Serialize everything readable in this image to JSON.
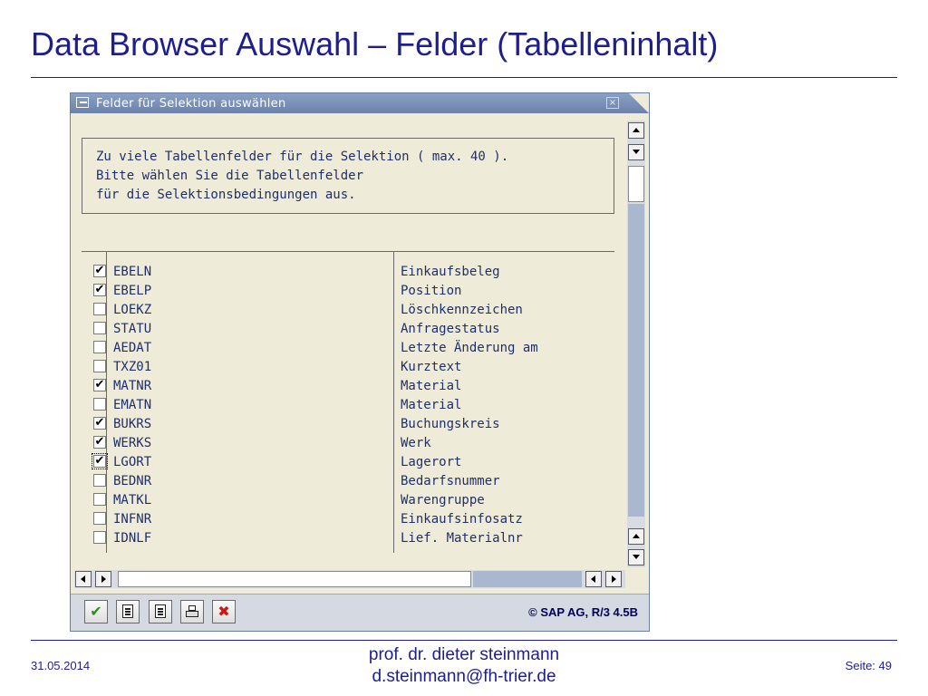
{
  "slide": {
    "title": "Data Browser Auswahl – Felder (Tabelleninhalt)"
  },
  "dialog": {
    "title": "Felder für Selektion auswählen",
    "message_lines": [
      "Zu viele Tabellenfelder für die Selektion ( max. 40 ).",
      "Bitte wählen Sie die Tabellenfelder",
      "für die Selektionsbedingungen aus."
    ],
    "rows": [
      {
        "field": "EBELN",
        "desc": "Einkaufsbeleg",
        "checked": true
      },
      {
        "field": "EBELP",
        "desc": "Position",
        "checked": true
      },
      {
        "field": "LOEKZ",
        "desc": "Löschkennzeichen",
        "checked": false
      },
      {
        "field": "STATU",
        "desc": "Anfragestatus",
        "checked": false
      },
      {
        "field": "AEDAT",
        "desc": "Letzte Änderung am",
        "checked": false
      },
      {
        "field": "TXZ01",
        "desc": "Kurztext",
        "checked": false
      },
      {
        "field": "MATNR",
        "desc": "Material",
        "checked": true
      },
      {
        "field": "EMATN",
        "desc": "Material",
        "checked": false
      },
      {
        "field": "BUKRS",
        "desc": "Buchungskreis",
        "checked": true
      },
      {
        "field": "WERKS",
        "desc": "Werk",
        "checked": true
      },
      {
        "field": "LGORT",
        "desc": "Lagerort",
        "checked": true,
        "focused": true
      },
      {
        "field": "BEDNR",
        "desc": "Bedarfsnummer",
        "checked": false
      },
      {
        "field": "MATKL",
        "desc": "Warengruppe",
        "checked": false
      },
      {
        "field": "INFNR",
        "desc": "Einkaufsinfosatz",
        "checked": false
      },
      {
        "field": "IDNLF",
        "desc": "Lief. Materialnr",
        "checked": false
      }
    ],
    "toolbar": {
      "copyright": "© SAP AG, R/3 4.5B",
      "buttons": [
        "ok-icon",
        "select-all-icon",
        "deselect-all-icon",
        "print-icon",
        "cancel-icon"
      ]
    }
  },
  "footer": {
    "date": "31.05.2014",
    "author_name": "prof. dr. dieter steinmann",
    "author_email": "d.steinmann@fh-trier.de",
    "page": "Seite: 49"
  },
  "colors": {
    "slide_title": "#1e1e8c",
    "dialog_background": "#efebd9",
    "titlebar": "#7b90b8",
    "text": "#1f2f6a",
    "ok_green": "#2f8a1f",
    "cancel_red": "#d01515"
  }
}
